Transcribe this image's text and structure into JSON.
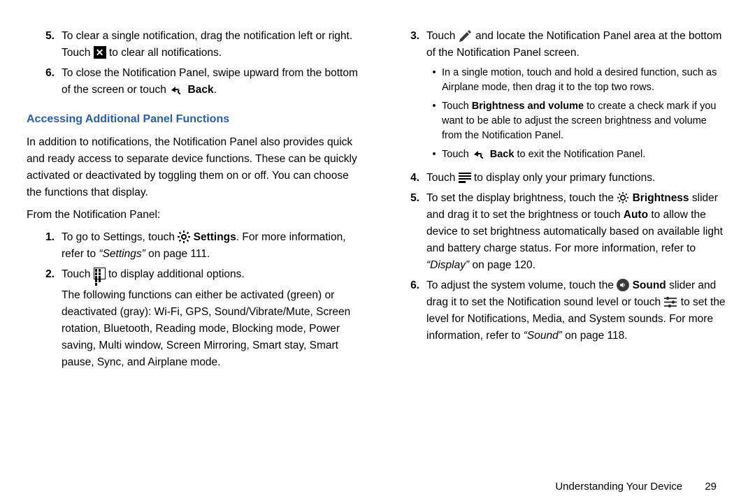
{
  "left": {
    "items_a": [
      {
        "n": "5.",
        "parts": [
          {
            "t": "To clear a single notification, drag the notification left or right. Touch "
          },
          {
            "icon": "close-icon"
          },
          {
            "t": " to clear all notifications."
          }
        ]
      },
      {
        "n": "6.",
        "parts": [
          {
            "t": "To close the Notification Panel, swipe upward from the bottom of the screen or touch "
          },
          {
            "icon": "back-icon"
          },
          {
            "t": " "
          },
          {
            "b": "Back"
          },
          {
            "t": "."
          }
        ]
      }
    ],
    "heading": "Accessing Additional Panel Functions",
    "intro": "In addition to notifications, the Notification Panel also provides quick and ready access to separate device functions. These can be quickly activated or deactivated by toggling them on or off. You can choose the functions that display.",
    "from": "From the Notification Panel:",
    "items_b": [
      {
        "n": "1.",
        "parts": [
          {
            "t": "To go to Settings, touch "
          },
          {
            "icon": "gear-icon"
          },
          {
            "t": " "
          },
          {
            "b": "Settings"
          },
          {
            "t": ". For more information, refer to "
          },
          {
            "i": "“Settings”"
          },
          {
            "t": " on page 111."
          }
        ]
      },
      {
        "n": "2.",
        "parts": [
          {
            "t": "Touch "
          },
          {
            "icon": "grid-icon"
          },
          {
            "t": " to display additional options."
          }
        ],
        "extra": "The following functions can either be activated (green) or deactivated (gray): Wi-Fi, GPS, Sound/Vibrate/Mute, Screen rotation, Bluetooth, Reading mode, Blocking mode, Power saving, Multi window, Screen Mirroring, Smart stay, Smart pause, Sync, and Airplane mode."
      }
    ]
  },
  "right": {
    "items": [
      {
        "n": "3.",
        "parts": [
          {
            "t": "Touch "
          },
          {
            "icon": "pencil-icon"
          },
          {
            "t": " and locate the Notification Panel area at the bottom of the Notification Panel screen."
          }
        ],
        "subs": [
          [
            {
              "t": "In a single motion, touch and hold a desired function, such as Airplane mode, then drag it to the top two rows."
            }
          ],
          [
            {
              "t": "Touch "
            },
            {
              "b": "Brightness and volume"
            },
            {
              "t": " to create a check mark if you want to be able to adjust the screen brightness and volume from the Notification Panel."
            }
          ],
          [
            {
              "t": "Touch "
            },
            {
              "icon": "back-icon"
            },
            {
              "t": " "
            },
            {
              "b": "Back"
            },
            {
              "t": " to exit the Notification Panel."
            }
          ]
        ]
      },
      {
        "n": "4.",
        "parts": [
          {
            "t": "Touch "
          },
          {
            "icon": "lines-icon"
          },
          {
            "t": " to display only your primary functions."
          }
        ]
      },
      {
        "n": "5.",
        "parts": [
          {
            "t": "To set the display brightness, touch the "
          },
          {
            "icon": "sun-icon"
          },
          {
            "t": " "
          },
          {
            "b": "Brightness"
          },
          {
            "t": " slider and drag it to set the brightness or touch "
          },
          {
            "b": "Auto"
          },
          {
            "t": " to allow the device to set brightness automatically based on available light and battery charge status. For more information, refer to "
          },
          {
            "i": "“Display”"
          },
          {
            "t": " on page 120."
          }
        ]
      },
      {
        "n": "6.",
        "parts": [
          {
            "t": "To adjust the system volume, touch the "
          },
          {
            "icon": "speaker-icon"
          },
          {
            "t": " "
          },
          {
            "b": "Sound"
          },
          {
            "t": " slider and drag it to set the Notification sound level or touch "
          },
          {
            "icon": "sliders-icon"
          },
          {
            "t": " to set the level for Notifications, Media, and System sounds. For more information, refer to "
          },
          {
            "i": "“Sound”"
          },
          {
            "t": " on page 118."
          }
        ]
      }
    ]
  },
  "footer": {
    "section": "Understanding Your Device",
    "page": "29"
  }
}
